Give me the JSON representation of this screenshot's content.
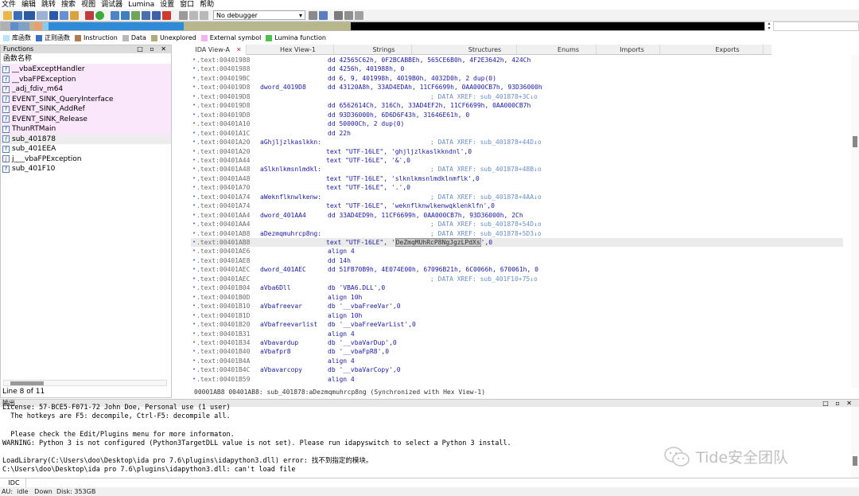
{
  "menu": [
    "文件",
    "编辑",
    "跳转",
    "搜索",
    "视图",
    "调试器",
    "Lumina",
    "设置",
    "窗口",
    "帮助"
  ],
  "toolbar": {
    "debugger_value": "No debugger"
  },
  "navband_colors": [
    "#b0b0b0",
    "#5f8fca",
    "#7fa0c8",
    "#c0b48a",
    "#e8a070",
    "#90c8e8",
    "#2f8ad8",
    "#b8b78a",
    "#000000"
  ],
  "legend": [
    {
      "label": "库函数",
      "color": "#b9e5fb"
    },
    {
      "label": "正则函数",
      "color": "#3b6fc3"
    },
    {
      "label": "Instruction",
      "color": "#b07b4e"
    },
    {
      "label": "Data",
      "color": "#b8b8b8"
    },
    {
      "label": "Unexplored",
      "color": "#b0ab7a"
    },
    {
      "label": "External symbol",
      "color": "#f3b3f3"
    },
    {
      "label": "Lumina function",
      "color": "#4cc04c"
    }
  ],
  "functions": {
    "title": "Functions",
    "header": "函数名称",
    "items": [
      {
        "name": "__vbaExceptHandler",
        "lib": true
      },
      {
        "name": "__vbaFPException",
        "lib": true
      },
      {
        "name": "_adj_fdiv_m64",
        "lib": true
      },
      {
        "name": "EVENT_SINK_QueryInterface",
        "lib": true
      },
      {
        "name": "EVENT_SINK_AddRef",
        "lib": true
      },
      {
        "name": "EVENT_SINK_Release",
        "lib": true
      },
      {
        "name": "ThunRTMain",
        "lib": true
      },
      {
        "name": "sub_401878",
        "lib": false,
        "selected": true
      },
      {
        "name": "sub_401EEA",
        "lib": false
      },
      {
        "name": "j___vbaFPException",
        "lib": false,
        "icon": "j"
      },
      {
        "name": "sub_401F10",
        "lib": false
      }
    ],
    "status": "Line 8 of 11"
  },
  "tabs": [
    {
      "label": "IDA View-A",
      "active": true
    },
    {
      "label": "Hex View-1"
    },
    {
      "label": "Strings"
    },
    {
      "label": "Structures"
    },
    {
      "label": "Enums"
    },
    {
      "label": "Imports"
    },
    {
      "label": "Exports"
    }
  ],
  "disasm": [
    {
      "addr": ".text:00401988",
      "label": "",
      "instr": "dd 42565C62h, 0F2BCABBEh, 565CE6B0h, 4F2E3642h, 424Ch"
    },
    {
      "addr": ".text:00401988",
      "label": "",
      "instr": "dd 4256h, 401988h, 0"
    },
    {
      "addr": ".text:004019BC",
      "label": "",
      "instr": "dd 6, 9, 401998h, 4019B0h, 4032D0h, 2 dup(0)"
    },
    {
      "addr": ".text:004019D8",
      "label": "dword_4019D8",
      "instr": "dd 43120A8h, 33AD4EDAh, 11CF6699h, 0AA000CB7h, 93D36000h"
    },
    {
      "addr": ".text:004019D8",
      "label": "",
      "instr": "",
      "xref": "; DATA XREF: sub_401878+3C↓o"
    },
    {
      "addr": ".text:004019D8",
      "label": "",
      "instr": "dd 6562614Ch, 316Ch, 33AD4EF2h, 11CF6699h, 0AA000CB7h"
    },
    {
      "addr": ".text:004019D8",
      "label": "",
      "instr": "dd 93D36000h, 6D6D6F43h, 31646E61h, 0"
    },
    {
      "addr": ".text:00401A10",
      "label": "",
      "instr": "dd 50000Ch, 2 dup(0)"
    },
    {
      "addr": ".text:00401A1C",
      "label": "",
      "instr": "dd 22h"
    },
    {
      "addr": ".text:00401A20",
      "label": "aGhjljzlkaslkkn:",
      "instr": "",
      "xref": "; DATA XREF: sub_401878+44D↓o"
    },
    {
      "addr": ".text:00401A20",
      "label": "",
      "instr": "text \"UTF-16LE\", 'ghjljzlkaslkkndnl',0",
      "w": true
    },
    {
      "addr": ".text:00401A44",
      "label": "",
      "instr": "text \"UTF-16LE\", '&',0",
      "w": true
    },
    {
      "addr": ".text:00401A48",
      "label": "aSlknlkmsnlmdkl:",
      "instr": "",
      "xref": "; DATA XREF: sub_401878+48B↓o"
    },
    {
      "addr": ".text:00401A48",
      "label": "",
      "instr": "text \"UTF-16LE\", 'slknlkmsnlmdklnmflk',0",
      "w": true
    },
    {
      "addr": ".text:00401A70",
      "label": "",
      "instr": "text \"UTF-16LE\", '.',0",
      "w": true
    },
    {
      "addr": ".text:00401A74",
      "label": "aWeknflknwlkenw:",
      "instr": "",
      "xref": "; DATA XREF: sub_401878+4AA↓o"
    },
    {
      "addr": ".text:00401A74",
      "label": "",
      "instr": "text \"UTF-16LE\", 'weknflknwlkenwqklenklfn',0",
      "w": true
    },
    {
      "addr": ".text:00401AA4",
      "label": "dword_401AA4",
      "instr": "dd 33AD4ED9h, 11CF6699h, 0AA000CB7h, 93D36000h, 2Ch"
    },
    {
      "addr": ".text:00401AA4",
      "label": "",
      "instr": "",
      "xref": "; DATA XREF: sub_401878+54D↓o"
    },
    {
      "addr": ".text:00401AB8",
      "label": "aDezmqmuhrcp8ng:",
      "instr": "",
      "xref": "; DATA XREF: sub_401878+5D3↓o"
    },
    {
      "addr": ".text:00401AB8",
      "label": "",
      "instr": "text \"UTF-16LE\", '",
      "sel": "DeZmqMUhRcP8NgJgzLPdXs",
      "tail": "',0",
      "w": true,
      "hl": true
    },
    {
      "addr": ".text:00401AE6",
      "label": "",
      "instr": "align 4"
    },
    {
      "addr": ".text:00401AE8",
      "label": "",
      "instr": "dd 14h"
    },
    {
      "addr": ".text:00401AEC",
      "label": "dword_401AEC",
      "instr": "dd 51FB70B9h, 4E074E00h, 67096B21h, 6C0066h, 670061h, 0"
    },
    {
      "addr": ".text:00401AEC",
      "label": "",
      "instr": "",
      "xref": "; DATA XREF: sub_401F10+75↓o"
    },
    {
      "addr": ".text:00401B04",
      "label": "aVba6Dll",
      "instr": "db 'VBA6.DLL',0"
    },
    {
      "addr": ".text:00401B0D",
      "label": "",
      "instr": "align 10h"
    },
    {
      "addr": ".text:00401B10",
      "label": "aVbafreevar",
      "instr": "db '__vbaFreeVar',0"
    },
    {
      "addr": ".text:00401B1D",
      "label": "",
      "instr": "align 10h"
    },
    {
      "addr": ".text:00401B20",
      "label": "aVbafreevarlist",
      "instr": "db '__vbaFreeVarList',0"
    },
    {
      "addr": ".text:00401B31",
      "label": "",
      "instr": "align 4"
    },
    {
      "addr": ".text:00401B34",
      "label": "aVbavardup",
      "instr": "db '__vbaVarDup',0"
    },
    {
      "addr": ".text:00401B40",
      "label": "aVbafpr8",
      "instr": "db '__vbaFpR8',0"
    },
    {
      "addr": ".text:00401B4A",
      "label": "",
      "instr": "align 4"
    },
    {
      "addr": ".text:00401B4C",
      "label": "aVbavarcopy",
      "instr": "db '__vbaVarCopy',0"
    },
    {
      "addr": ".text:00401B59",
      "label": "",
      "instr": "align 4"
    }
  ],
  "status_line": "00001AB8 00401AB8: sub_401878:aDezmqmuhrcp8ng (Synchronized with Hex View-1)",
  "output": {
    "title": "输出",
    "lines": [
      "License: 57-BCE5-F071-72 John Doe, Personal use (1 user)",
      "  The hotkeys are F5: decompile, Ctrl-F5: decompile all.",
      "",
      "  Please check the Edit/Plugins menu for more informaton.",
      "WARNING: Python 3 is not configured (Python3TargetDLL value is not set). Please run idapyswitch to select a Python 3 install.",
      "",
      "LoadLibrary(C:\\Users\\doo\\Desktop\\ida pro 7.6\\plugins\\idapython3.dll) error: 找不到指定的模块。",
      "C:\\Users\\doo\\Desktop\\ida pro 7.6\\plugins\\idapython3.dll: can't load file"
    ]
  },
  "watermark": "Tide安全团队",
  "idc_label": "IDC",
  "bottom_status": "AU:  idle   Down  Disk: 353GB"
}
